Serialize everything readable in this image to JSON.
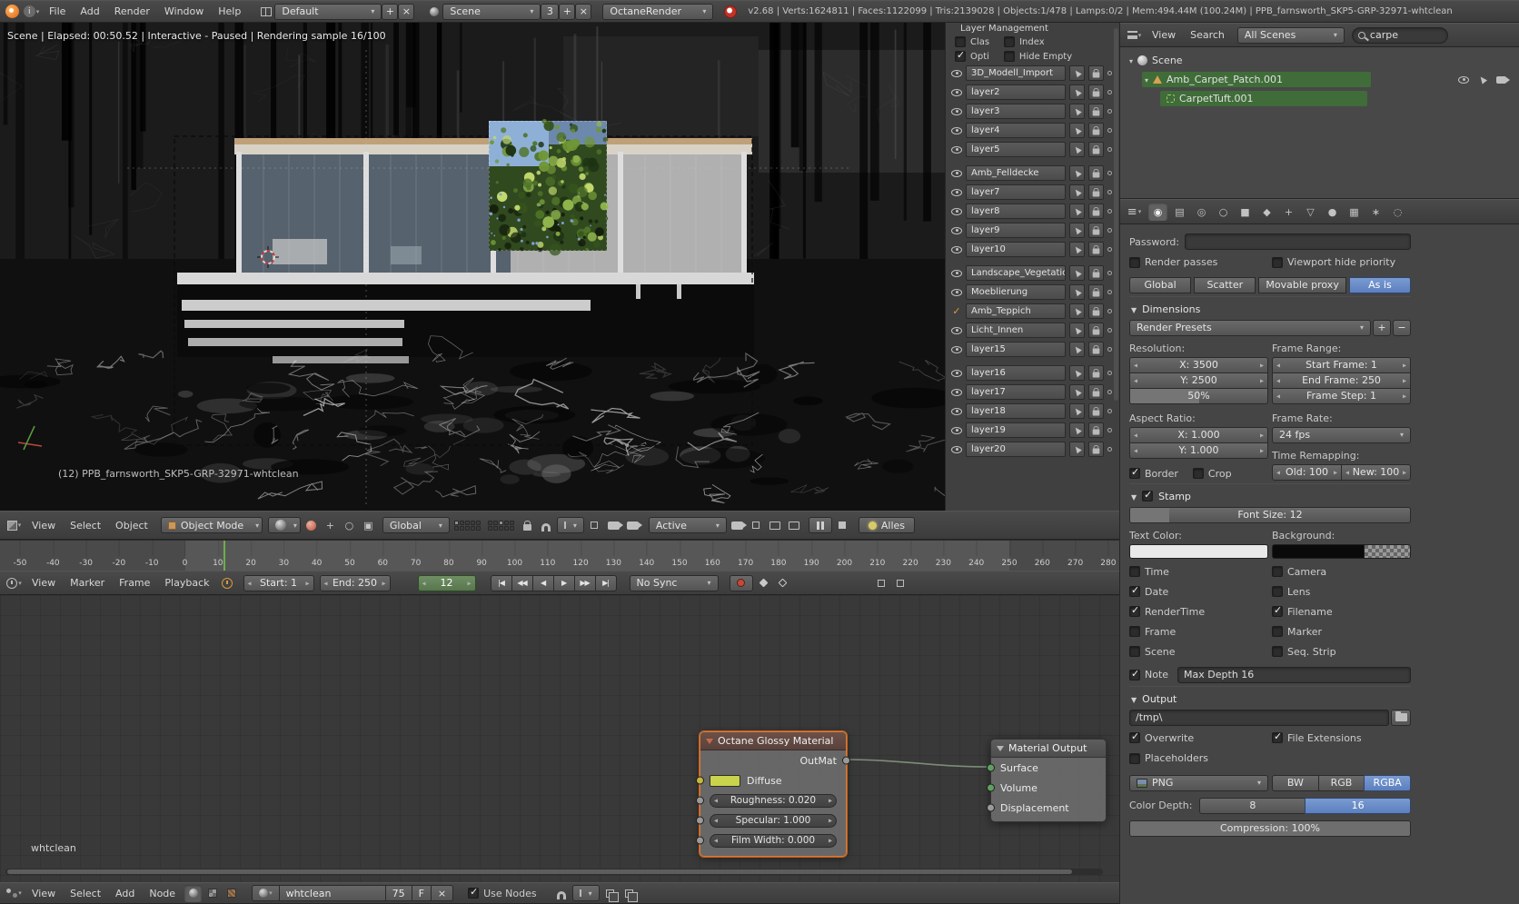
{
  "glyphs": {
    "plus": "+",
    "close": "×",
    "minus": "−",
    "check": "✓"
  },
  "top": {
    "menus": [
      "File",
      "Add",
      "Render",
      "Window",
      "Help"
    ],
    "layout": "Default",
    "scene": "Scene",
    "scene_users": "3",
    "engine": "OctaneRender",
    "stats": "v2.68 | Verts:1624811 | Faces:1122099 | Tris:2139028 | Objects:1/478 | Lamps:0/2 | Mem:494.44M (100.24M) | PPB_farnsworth_SKP5-GRP-32971-whtclean"
  },
  "viewport": {
    "status": "Scene | Elapsed: 00:50.52 | Interactive - Paused | Rendering sample 16/100",
    "label": "(12) PPB_farnsworth_SKP5-GRP-32971-whtclean",
    "menus": [
      "View",
      "Select",
      "Object"
    ],
    "mode": "Object Mode",
    "orientation": "Global",
    "active": "Active",
    "alles": "Alles"
  },
  "layers": {
    "title": "Layer Management",
    "row1": [
      {
        "label": "Clas",
        "checked": false
      },
      {
        "label": "Index",
        "checked": false
      }
    ],
    "row2": [
      {
        "label": "Opti",
        "checked": true
      },
      {
        "label": "Hide Empty",
        "checked": false
      }
    ],
    "active": "Amb_Teppich",
    "groups": [
      [
        "3D_Modell_Import",
        "layer2",
        "layer3",
        "layer4",
        "layer5"
      ],
      [
        "Amb_Felldecke",
        "layer7",
        "layer8",
        "layer9",
        "layer10"
      ],
      [
        "Landscape_Vegetation",
        "Moeblierung",
        "Amb_Teppich",
        "Licht_Innen",
        "layer15"
      ],
      [
        "layer16",
        "layer17",
        "layer18",
        "layer19",
        "layer20"
      ]
    ]
  },
  "timeline": {
    "menus": [
      "View",
      "Marker",
      "Frame",
      "Playback"
    ],
    "ticks": [
      "-50",
      "-40",
      "-30",
      "-20",
      "-10",
      "0",
      "10",
      "20",
      "30",
      "40",
      "50",
      "60",
      "70",
      "80",
      "90",
      "100",
      "110",
      "120",
      "130",
      "140",
      "150",
      "160",
      "170",
      "180",
      "190",
      "200",
      "210",
      "220",
      "230",
      "240",
      "250",
      "260",
      "270",
      "280"
    ],
    "start": "Start: 1",
    "end": "End: 250",
    "frame": "12",
    "transport": [
      "|◀",
      "◀◀",
      "◀",
      "▶",
      "▶▶",
      "▶|"
    ],
    "sync": "No Sync"
  },
  "node_editor": {
    "watermark": "whtclean",
    "menus": [
      "View",
      "Select",
      "Add",
      "Node"
    ],
    "glossy_node": {
      "title": "Octane Glossy Material",
      "output_label": "OutMat",
      "diffuse_label": "Diffuse",
      "diffuse_color": "#c9d34b",
      "sliders": [
        "Roughness: 0.020",
        "Specular: 1.000",
        "Film Width: 0.000"
      ]
    },
    "output_node": {
      "title": "Material Output",
      "inputs": [
        "Surface",
        "Volume",
        "Displacement"
      ]
    },
    "material_name": "whtclean",
    "material_users": "75",
    "fake_user": "F",
    "use_nodes": {
      "label": "Use Nodes",
      "checked": true
    }
  },
  "outliner": {
    "menus": [
      "View",
      "Search"
    ],
    "scope": "All Scenes",
    "search": "carpe",
    "rows": [
      {
        "label": "Scene"
      },
      {
        "label": "Amb_Carpet_Patch.001"
      },
      {
        "label": "CarpetTuft.001"
      }
    ]
  },
  "props": {
    "tab_active": "render",
    "tabs": [
      {
        "name": "render",
        "glyph": "◉"
      },
      {
        "name": "render-layers",
        "glyph": "▤"
      },
      {
        "name": "scene",
        "glyph": "◎"
      },
      {
        "name": "world",
        "glyph": "○"
      },
      {
        "name": "object",
        "glyph": "■"
      },
      {
        "name": "constraints",
        "glyph": "◆"
      },
      {
        "name": "modifiers",
        "glyph": "+"
      },
      {
        "name": "data",
        "glyph": "▽"
      },
      {
        "name": "material",
        "glyph": "●"
      },
      {
        "name": "texture",
        "glyph": "▦"
      },
      {
        "name": "particles",
        "glyph": "∗"
      },
      {
        "name": "physics",
        "glyph": "◌"
      }
    ],
    "password_label": "Password:",
    "render_passes": {
      "label": "Render passes",
      "checked": false
    },
    "viewport_hide": {
      "label": "Viewport hide priority",
      "checked": false
    },
    "proxy": [
      "Global",
      "Scatter",
      "Movable proxy",
      "As is"
    ],
    "proxy_active": "As is",
    "dimensions_title": "Dimensions",
    "render_presets": "Render Presets",
    "resolution_label": "Resolution:",
    "frame_range_label": "Frame Range:",
    "res": [
      "X: 3500",
      "Y: 2500",
      "50%"
    ],
    "frames": [
      "Start Frame: 1",
      "End Frame: 250",
      "Frame Step: 1"
    ],
    "aspect_label": "Aspect Ratio:",
    "frame_rate_label": "Frame Rate:",
    "aspect": [
      "X: 1.000",
      "Y: 1.000"
    ],
    "fps": "24 fps",
    "remap_label": "Time Remapping:",
    "remap_old": "Old: 100",
    "remap_new": "New: 100",
    "border": {
      "label": "Border",
      "checked": true
    },
    "crop": {
      "label": "Crop",
      "checked": false
    },
    "stamp_title": "Stamp",
    "stamp_enabled": {
      "label": "",
      "checked": true
    },
    "font_size": "Font Size: 12",
    "text_color_label": "Text Color:",
    "background_label": "Background:",
    "stamp_left": [
      {
        "label": "Time",
        "checked": false
      },
      {
        "label": "Date",
        "checked": true
      },
      {
        "label": "RenderTime",
        "checked": true
      },
      {
        "label": "Frame",
        "checked": false
      },
      {
        "label": "Scene",
        "checked": false
      }
    ],
    "stamp_right": [
      {
        "label": "Camera",
        "checked": false
      },
      {
        "label": "Lens",
        "checked": false
      },
      {
        "label": "Filename",
        "checked": true
      },
      {
        "label": "Marker",
        "checked": false
      },
      {
        "label": "Seq. Strip",
        "checked": false
      }
    ],
    "note": {
      "label": "Note",
      "checked": true
    },
    "note_value": "Max Depth 16",
    "output_title": "Output",
    "output_path": "/tmp\\",
    "overwrite": {
      "label": "Overwrite",
      "checked": true
    },
    "file_extensions": {
      "label": "File Extensions",
      "checked": true
    },
    "placeholders": {
      "label": "Placeholders",
      "checked": false
    },
    "format": "PNG",
    "channels": [
      "BW",
      "RGB",
      "RGBA"
    ],
    "channels_active": "RGBA",
    "color_depth_label": "Color Depth:",
    "depths": [
      "8",
      "16"
    ],
    "depth_active": "16",
    "compression": "Compression: 100%"
  }
}
